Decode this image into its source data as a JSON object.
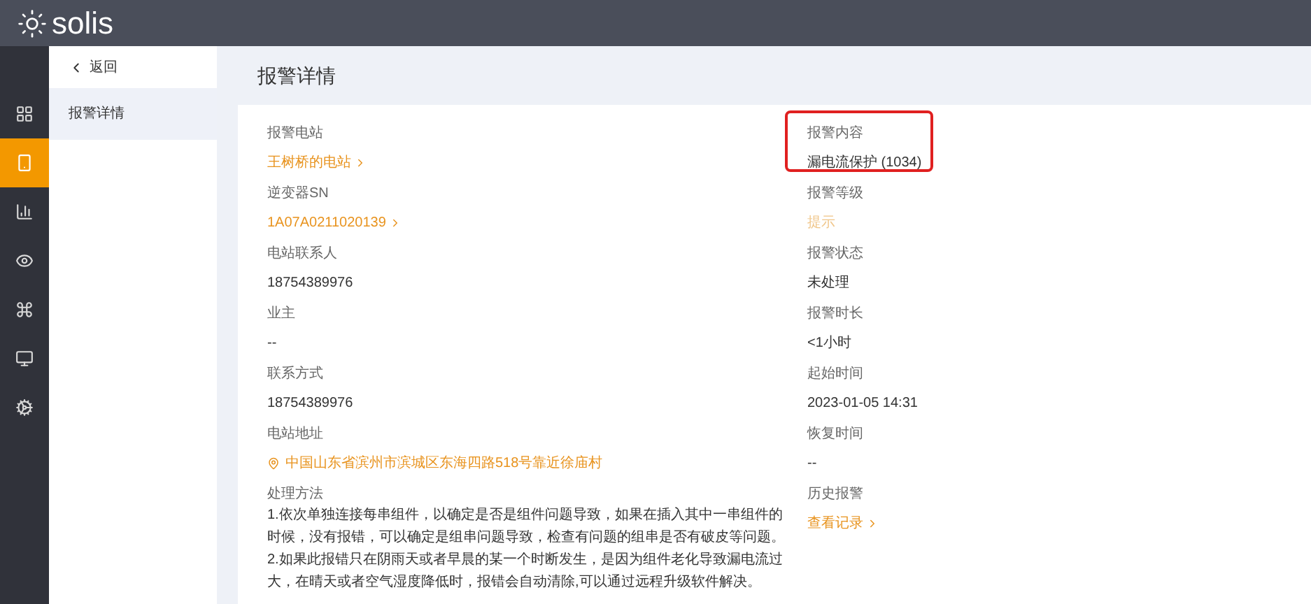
{
  "header": {
    "logo_text": "solis"
  },
  "rail": [
    {
      "selected": false
    },
    {
      "selected": true
    },
    {
      "selected": false
    },
    {
      "selected": false
    },
    {
      "selected": false
    },
    {
      "selected": false
    },
    {
      "selected": false
    }
  ],
  "submenu": {
    "back": "返回",
    "items": [
      {
        "label": "报警详情",
        "selected": true
      }
    ]
  },
  "page_title": "报警详情",
  "left_fields": [
    {
      "label": "报警电站",
      "value": "王树桥的电站",
      "kind": "link",
      "highlighted": false
    },
    {
      "label": "逆变器SN",
      "value": "1A07A0211020139",
      "kind": "link",
      "highlighted": false
    },
    {
      "label": "电站联系人",
      "value": "18754389976",
      "kind": "text",
      "highlighted": false
    },
    {
      "label": "业主",
      "value": "--",
      "kind": "text",
      "highlighted": false
    },
    {
      "label": "联系方式",
      "value": "18754389976",
      "kind": "text",
      "highlighted": false
    },
    {
      "label": "电站地址",
      "value": "中国山东省滨州市滨城区东海四路518号靠近徐庙村",
      "kind": "address",
      "highlighted": false
    }
  ],
  "right_fields": [
    {
      "label": "报警内容",
      "value": "漏电流保护 (1034)",
      "kind": "text",
      "highlighted": true
    },
    {
      "label": "报警等级",
      "value": "提示",
      "kind": "level",
      "highlighted": false
    },
    {
      "label": "报警状态",
      "value": "未处理",
      "kind": "text",
      "highlighted": false
    },
    {
      "label": "报警时长",
      "value": "<1小时",
      "kind": "text",
      "highlighted": false
    },
    {
      "label": "起始时间",
      "value": "2023-01-05 14:31",
      "kind": "text",
      "highlighted": false
    },
    {
      "label": "恢复时间",
      "value": "--",
      "kind": "text",
      "highlighted": false
    }
  ],
  "method": {
    "label": "处理方法",
    "paragraphs": [
      "1.依次单独连接每串组件，以确定是否是组件问题导致，如果在插入其中一串组件的时候，没有报错，可以确定是组串问题导致，检查有问题的组串是否有破皮等问题。",
      "2.如果此报错只在阴雨天或者早晨的某一个时断发生，是因为组件老化导致漏电流过大，在晴天或者空气湿度降低时，报错会自动清除,可以通过远程升级软件解决。"
    ]
  },
  "history": {
    "label": "历史报警",
    "link": "查看记录"
  }
}
